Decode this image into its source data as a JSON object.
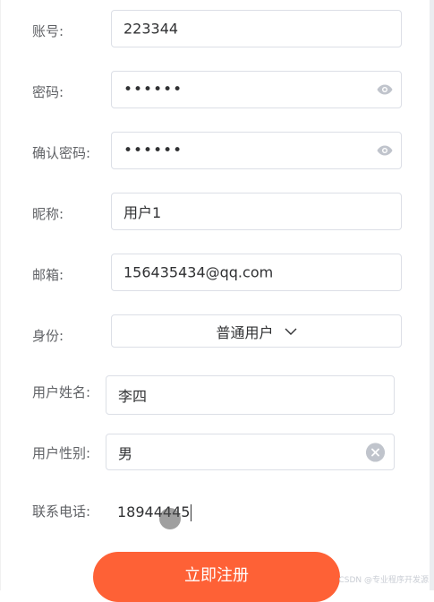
{
  "form": {
    "account": {
      "label": "账号:",
      "value": "223344"
    },
    "password": {
      "label": "密码:",
      "value": "••••••"
    },
    "confirm_password": {
      "label": "确认密码:",
      "value": "••••••"
    },
    "nickname": {
      "label": "昵称:",
      "value": "用户1"
    },
    "email": {
      "label": "邮箱:",
      "value": "156435434@qq.com"
    },
    "identity": {
      "label": "身份:",
      "value": "普通用户"
    },
    "real_name": {
      "label": "用户姓名:",
      "value": "李四"
    },
    "gender": {
      "label": "用户性别:",
      "value": "男"
    },
    "phone": {
      "label": "联系电话:",
      "value": "18944445"
    }
  },
  "submit": {
    "label": "立即注册"
  },
  "watermark": "CSDN @专业程序开发源",
  "colors": {
    "accent": "#fe6136",
    "border": "#dcdfe6",
    "label": "#606266",
    "icon": "#c0c4cc"
  },
  "icons": {
    "password_toggle": "eye-icon",
    "select_arrow": "chevron-down-icon",
    "clear": "clear-icon"
  }
}
